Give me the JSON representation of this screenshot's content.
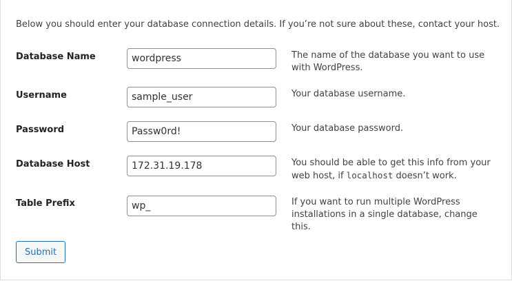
{
  "intro": "Below you should enter your database connection details. If you’re not sure about these, contact your host.",
  "fields": [
    {
      "label": "Database Name",
      "value": "wordpress",
      "desc_before": "The name of the database you want to use with WordPress.",
      "desc_code": "",
      "desc_after": ""
    },
    {
      "label": "Username",
      "value": "sample_user",
      "desc_before": "Your database username.",
      "desc_code": "",
      "desc_after": ""
    },
    {
      "label": "Password",
      "value": "Passw0rd!",
      "desc_before": "Your database password.",
      "desc_code": "",
      "desc_after": ""
    },
    {
      "label": "Database Host",
      "value": "172.31.19.178",
      "desc_before": "You should be able to get this info from your web host, if ",
      "desc_code": "localhost",
      "desc_after": " doesn’t work."
    },
    {
      "label": "Table Prefix",
      "value": "wp_",
      "desc_before": "If you want to run multiple WordPress installations in a single database, change this.",
      "desc_code": "",
      "desc_after": ""
    }
  ],
  "submit_label": "Submit"
}
